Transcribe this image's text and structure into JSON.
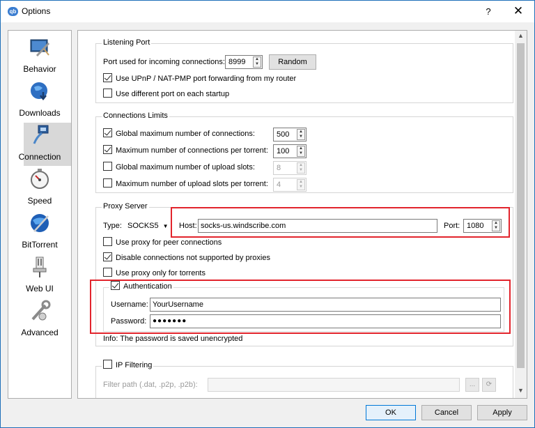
{
  "window": {
    "title": "Options",
    "app_icon": "qb",
    "help_glyph": "?",
    "close_glyph": "✕"
  },
  "sidebar": {
    "items": [
      {
        "label": "Behavior",
        "icon": "monitor-brush-icon"
      },
      {
        "label": "Downloads",
        "icon": "globe-download-icon"
      },
      {
        "label": "Connection",
        "icon": "network-plug-icon"
      },
      {
        "label": "Speed",
        "icon": "speedometer-icon"
      },
      {
        "label": "BitTorrent",
        "icon": "globe-bittorrent-icon"
      },
      {
        "label": "Web UI",
        "icon": "usb-cable-icon"
      },
      {
        "label": "Advanced",
        "icon": "wrench-icon"
      }
    ],
    "active_index": 2
  },
  "listening_port": {
    "title": "Listening Port",
    "port_label": "Port used for incoming connections:",
    "port_value": "8999",
    "random_label": "Random",
    "upnp_label": "Use UPnP / NAT-PMP port forwarding from my router",
    "upnp_checked": true,
    "diffport_label": "Use different port on each startup",
    "diffport_checked": false
  },
  "connection_limits": {
    "title": "Connections Limits",
    "rows": [
      {
        "label": "Global maximum number of connections:",
        "checked": true,
        "value": "500",
        "enabled": true
      },
      {
        "label": "Maximum number of connections per torrent:",
        "checked": true,
        "value": "100",
        "enabled": true
      },
      {
        "label": "Global maximum number of upload slots:",
        "checked": false,
        "value": "8",
        "enabled": false
      },
      {
        "label": "Maximum number of upload slots per torrent:",
        "checked": false,
        "value": "4",
        "enabled": false
      }
    ]
  },
  "proxy": {
    "title": "Proxy Server",
    "type_label": "Type:",
    "type_value": "SOCKS5",
    "host_label": "Host:",
    "host_value": "socks-us.windscribe.com",
    "port_label": "Port:",
    "port_value": "1080",
    "peer_label": "Use proxy for peer connections",
    "peer_checked": false,
    "disable_label": "Disable connections not supported by proxies",
    "disable_checked": true,
    "torrents_only_label": "Use proxy only for torrents",
    "torrents_only_checked": false,
    "auth": {
      "title": "Authentication",
      "checked": true,
      "username_label": "Username:",
      "username_value": "YourUsername",
      "password_label": "Password:",
      "password_value": "●●●●●●●",
      "info": "Info: The password is saved unencrypted"
    }
  },
  "ip_filtering": {
    "title": "IP Filtering",
    "checked": false,
    "path_label": "Filter path (.dat, .p2p, .p2b):",
    "path_value": "",
    "browse_label": "..."
  },
  "footer": {
    "ok": "OK",
    "cancel": "Cancel",
    "apply": "Apply"
  },
  "colors": {
    "highlight_box": "#e2242c",
    "default_button_border": "#0078d7"
  }
}
